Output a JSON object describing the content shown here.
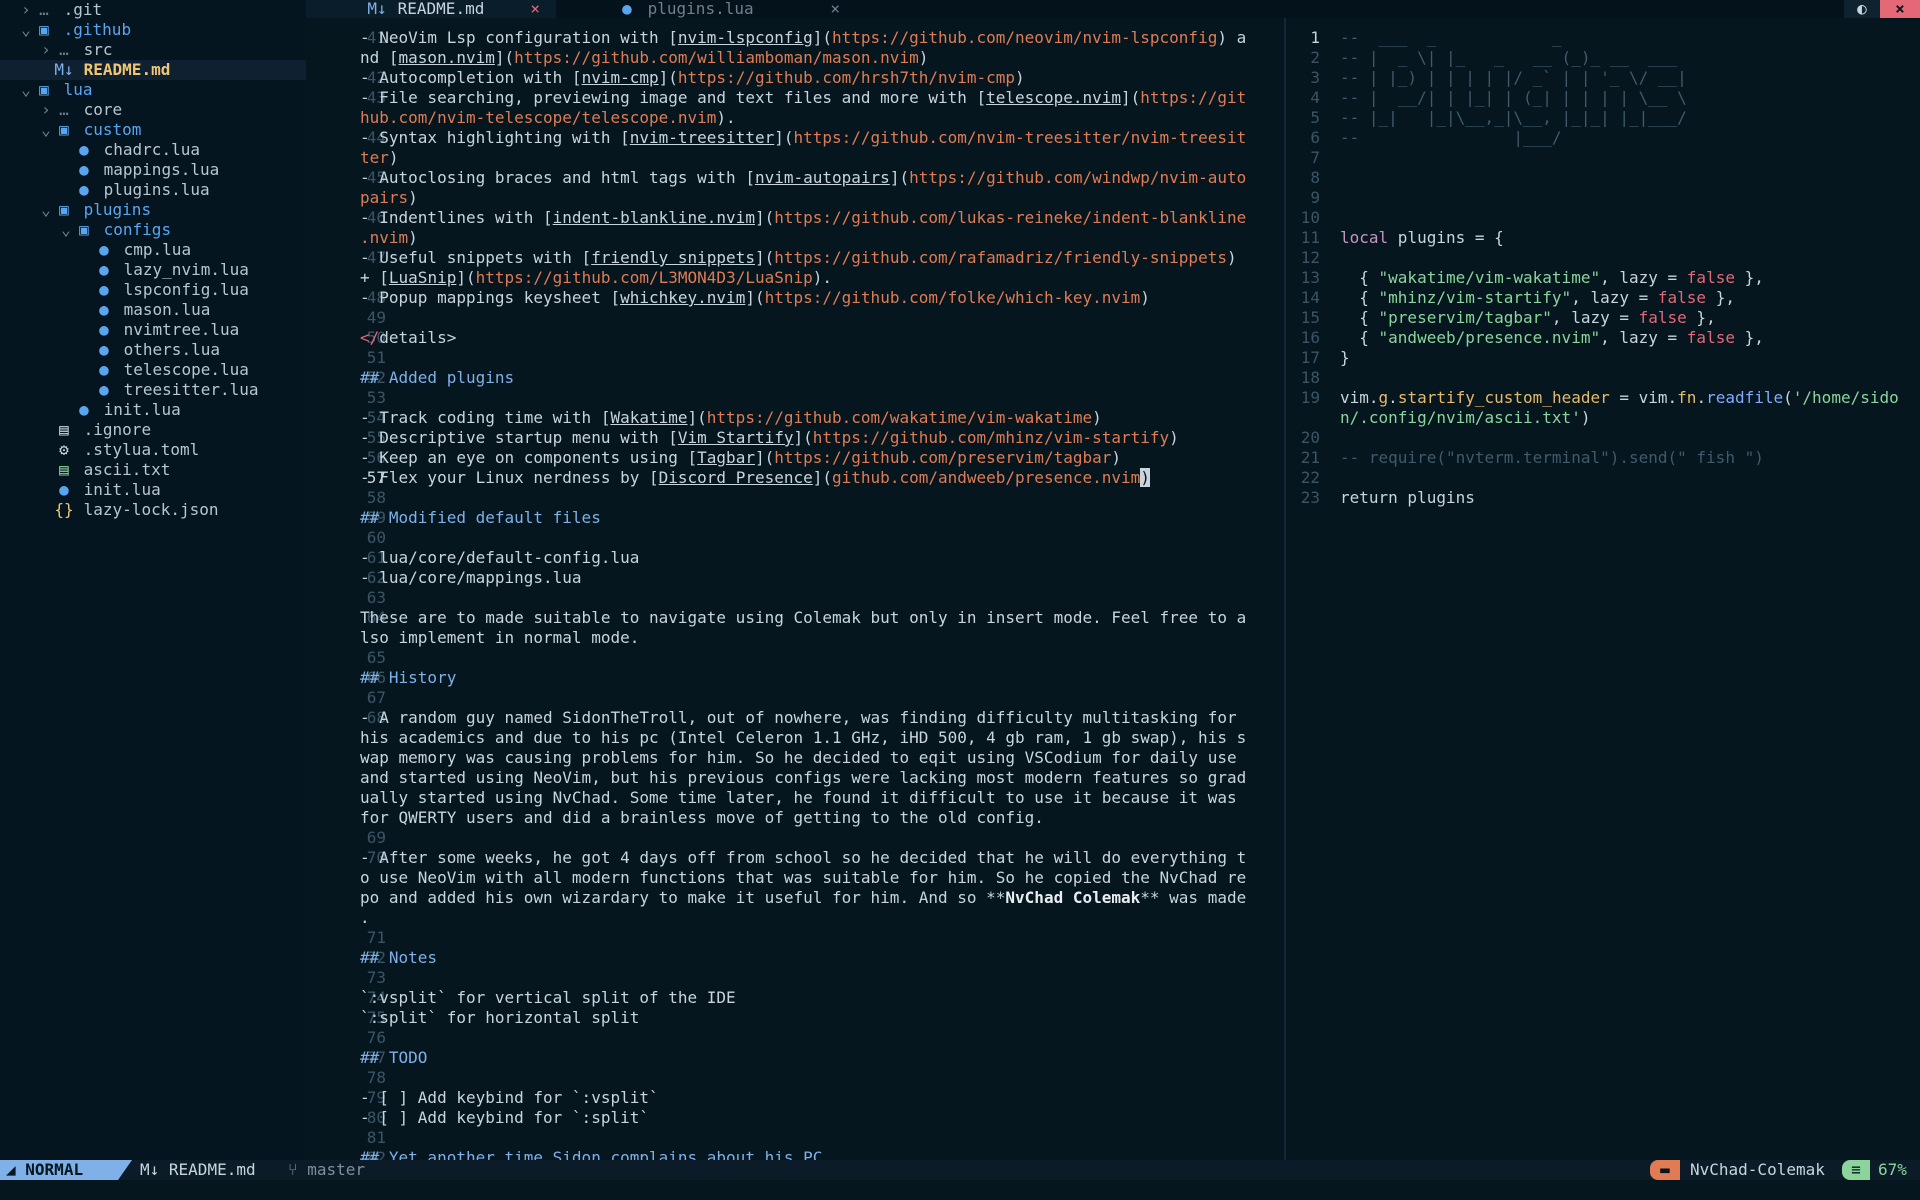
{
  "tree": [
    {
      "depth": 0,
      "arrow": "›",
      "icon": "…",
      "name": ".git",
      "kind": "hidden-dir",
      "icon_name": "dots-icon"
    },
    {
      "depth": 0,
      "arrow": "⌄",
      "icon": "▣",
      "name": ".github",
      "kind": "folder",
      "icon_name": "folder-open-icon"
    },
    {
      "depth": 1,
      "arrow": "›",
      "icon": "…",
      "name": "src",
      "kind": "hidden-dir",
      "icon_name": "dots-icon"
    },
    {
      "depth": 1,
      "arrow": "",
      "icon": "M↓",
      "name": "README.md",
      "kind": "active",
      "icon_name": "markdown-icon"
    },
    {
      "depth": 0,
      "arrow": "⌄",
      "icon": "▣",
      "name": "lua",
      "kind": "folder",
      "icon_name": "folder-open-icon"
    },
    {
      "depth": 1,
      "arrow": "›",
      "icon": "…",
      "name": "core",
      "kind": "hidden-dir",
      "icon_name": "dots-icon"
    },
    {
      "depth": 1,
      "arrow": "⌄",
      "icon": "▣",
      "name": "custom",
      "kind": "folder",
      "icon_name": "folder-open-icon"
    },
    {
      "depth": 2,
      "arrow": "",
      "icon": "●",
      "name": "chadrc.lua",
      "kind": "file",
      "icon_name": "lua-icon"
    },
    {
      "depth": 2,
      "arrow": "",
      "icon": "●",
      "name": "mappings.lua",
      "kind": "file",
      "icon_name": "lua-icon"
    },
    {
      "depth": 2,
      "arrow": "",
      "icon": "●",
      "name": "plugins.lua",
      "kind": "file",
      "icon_name": "lua-icon"
    },
    {
      "depth": 1,
      "arrow": "⌄",
      "icon": "▣",
      "name": "plugins",
      "kind": "folder",
      "icon_name": "folder-open-icon"
    },
    {
      "depth": 2,
      "arrow": "⌄",
      "icon": "▣",
      "name": "configs",
      "kind": "folder",
      "icon_name": "folder-open-icon"
    },
    {
      "depth": 3,
      "arrow": "",
      "icon": "●",
      "name": "cmp.lua",
      "kind": "file",
      "icon_name": "lua-icon"
    },
    {
      "depth": 3,
      "arrow": "",
      "icon": "●",
      "name": "lazy_nvim.lua",
      "kind": "file",
      "icon_name": "lua-icon"
    },
    {
      "depth": 3,
      "arrow": "",
      "icon": "●",
      "name": "lspconfig.lua",
      "kind": "file",
      "icon_name": "lua-icon"
    },
    {
      "depth": 3,
      "arrow": "",
      "icon": "●",
      "name": "mason.lua",
      "kind": "file",
      "icon_name": "lua-icon"
    },
    {
      "depth": 3,
      "arrow": "",
      "icon": "●",
      "name": "nvimtree.lua",
      "kind": "file",
      "icon_name": "lua-icon"
    },
    {
      "depth": 3,
      "arrow": "",
      "icon": "●",
      "name": "others.lua",
      "kind": "file",
      "icon_name": "lua-icon"
    },
    {
      "depth": 3,
      "arrow": "",
      "icon": "●",
      "name": "telescope.lua",
      "kind": "file",
      "icon_name": "lua-icon"
    },
    {
      "depth": 3,
      "arrow": "",
      "icon": "●",
      "name": "treesitter.lua",
      "kind": "file",
      "icon_name": "lua-icon"
    },
    {
      "depth": 2,
      "arrow": "",
      "icon": "●",
      "name": "init.lua",
      "kind": "file",
      "icon_name": "lua-icon"
    },
    {
      "depth": 1,
      "arrow": "",
      "icon": "▤",
      "name": ".ignore",
      "kind": "file",
      "icon_name": "text-file-icon"
    },
    {
      "depth": 1,
      "arrow": "",
      "icon": "⚙",
      "name": ".stylua.toml",
      "kind": "file",
      "icon_name": "gear-icon"
    },
    {
      "depth": 1,
      "arrow": "",
      "icon": "▤",
      "name": "ascii.txt",
      "kind": "file",
      "icon_name": "text-file-icon"
    },
    {
      "depth": 1,
      "arrow": "",
      "icon": "●",
      "name": "init.lua",
      "kind": "file",
      "icon_name": "lua-icon"
    },
    {
      "depth": 1,
      "arrow": "",
      "icon": "{}",
      "name": "lazy-lock.json",
      "kind": "file",
      "icon_name": "json-icon"
    }
  ],
  "tabs": [
    {
      "label": "README.md",
      "icon": "M↓",
      "close": "×"
    },
    {
      "label": "plugins.lua",
      "icon": "●",
      "close": "×"
    }
  ],
  "topbar": {
    "toggle": "◐",
    "close": "×"
  },
  "left_lines": [
    {
      "n": "41",
      "segs": [
        [
          "pn",
          "- NeoVim Lsp configuration with ["
        ],
        [
          "lnk",
          "nvim-lspconfig"
        ],
        [
          "pn",
          "]("
        ],
        [
          "url",
          "https://github.com/neovim/nvim-lspconfig"
        ],
        [
          "pn",
          ") a"
        ]
      ]
    },
    {
      "n": "",
      "segs": [
        [
          "pn",
          "nd ["
        ],
        [
          "lnk",
          "mason.nvim"
        ],
        [
          "pn",
          "]("
        ],
        [
          "url",
          "https://github.com/williamboman/mason.nvim"
        ],
        [
          "pn",
          ")"
        ]
      ]
    },
    {
      "n": "42",
      "segs": [
        [
          "pn",
          "- Autocompletion with ["
        ],
        [
          "lnk",
          "nvim-cmp"
        ],
        [
          "pn",
          "]("
        ],
        [
          "url",
          "https://github.com/hrsh7th/nvim-cmp"
        ],
        [
          "pn",
          ")"
        ]
      ]
    },
    {
      "n": "43",
      "segs": [
        [
          "pn",
          "- File searching, previewing image and text files and more with ["
        ],
        [
          "lnk",
          "telescope.nvim"
        ],
        [
          "pn",
          "]("
        ],
        [
          "url",
          "https://git"
        ]
      ]
    },
    {
      "n": "",
      "segs": [
        [
          "url",
          "hub.com/nvim-telescope/telescope.nvim"
        ],
        [
          "pn",
          ")."
        ]
      ]
    },
    {
      "n": "44",
      "segs": [
        [
          "pn",
          "- Syntax highlighting with ["
        ],
        [
          "lnk",
          "nvim-treesitter"
        ],
        [
          "pn",
          "]("
        ],
        [
          "url",
          "https://github.com/nvim-treesitter/nvim-treesit"
        ]
      ]
    },
    {
      "n": "",
      "segs": [
        [
          "url",
          "ter"
        ],
        [
          "pn",
          ")"
        ]
      ]
    },
    {
      "n": "45",
      "segs": [
        [
          "pn",
          "- Autoclosing braces and html tags with ["
        ],
        [
          "lnk",
          "nvim-autopairs"
        ],
        [
          "pn",
          "]("
        ],
        [
          "url",
          "https://github.com/windwp/nvim-auto"
        ]
      ]
    },
    {
      "n": "",
      "segs": [
        [
          "url",
          "pairs"
        ],
        [
          "pn",
          ")"
        ]
      ]
    },
    {
      "n": "46",
      "segs": [
        [
          "pn",
          "- Indentlines with ["
        ],
        [
          "lnk",
          "indent-blankline.nvim"
        ],
        [
          "pn",
          "]("
        ],
        [
          "url",
          "https://github.com/lukas-reineke/indent-blankline"
        ]
      ]
    },
    {
      "n": "",
      "segs": [
        [
          "url",
          ".nvim"
        ],
        [
          "pn",
          ")"
        ]
      ]
    },
    {
      "n": "47",
      "segs": [
        [
          "pn",
          "- Useful snippets with ["
        ],
        [
          "lnk",
          "friendly snippets"
        ],
        [
          "pn",
          "]("
        ],
        [
          "url",
          "https://github.com/rafamadriz/friendly-snippets"
        ],
        [
          "pn",
          ")"
        ]
      ]
    },
    {
      "n": "",
      "segs": [
        [
          "pn",
          "+ ["
        ],
        [
          "lnk",
          "LuaSnip"
        ],
        [
          "pn",
          "]("
        ],
        [
          "url",
          "https://github.com/L3MON4D3/LuaSnip"
        ],
        [
          "pn",
          ")."
        ]
      ]
    },
    {
      "n": "48",
      "segs": [
        [
          "pn",
          "- Popup mappings keysheet ["
        ],
        [
          "lnk",
          "whichkey.nvim"
        ],
        [
          "pn",
          "]("
        ],
        [
          "url",
          "https://github.com/folke/which-key.nvim"
        ],
        [
          "pn",
          ")"
        ]
      ]
    },
    {
      "n": "49",
      "segs": []
    },
    {
      "n": "50",
      "segs": [
        [
          "tag",
          "</"
        ],
        [
          "pn",
          "details>"
        ]
      ]
    },
    {
      "n": "51",
      "segs": []
    },
    {
      "n": "52",
      "segs": [
        [
          "h",
          "## Added plugins"
        ]
      ]
    },
    {
      "n": "53",
      "segs": []
    },
    {
      "n": "54",
      "segs": [
        [
          "pn",
          "- Track coding time with ["
        ],
        [
          "lnk",
          "Wakatime"
        ],
        [
          "pn",
          "]("
        ],
        [
          "url",
          "https://github.com/wakatime/vim-wakatime"
        ],
        [
          "pn",
          ")"
        ]
      ]
    },
    {
      "n": "55",
      "segs": [
        [
          "pn",
          "- Descriptive startup menu with ["
        ],
        [
          "lnk",
          "Vim Startify"
        ],
        [
          "pn",
          "]("
        ],
        [
          "url",
          "https://github.com/mhinz/vim-startify"
        ],
        [
          "pn",
          ")"
        ]
      ]
    },
    {
      "n": "56",
      "segs": [
        [
          "pn",
          "- Keep an eye on components using ["
        ],
        [
          "lnk",
          "Tagbar"
        ],
        [
          "pn",
          "]("
        ],
        [
          "url",
          "https://github.com/preservim/tagbar"
        ],
        [
          "pn",
          ")"
        ]
      ]
    },
    {
      "n": "57",
      "cur": true,
      "segs": [
        [
          "pn",
          "- Flex your Linux nerdness by ["
        ],
        [
          "lnk",
          "Discord Presence"
        ],
        [
          "pn",
          "]("
        ],
        [
          "url",
          "github.com/andweeb/presence.nvim"
        ],
        [
          "cursor",
          ")"
        ]
      ]
    },
    {
      "n": "58",
      "segs": []
    },
    {
      "n": "59",
      "segs": [
        [
          "h",
          "## Modified default files"
        ]
      ]
    },
    {
      "n": "60",
      "segs": []
    },
    {
      "n": "61",
      "segs": [
        [
          "pn",
          "- lua/core/default-config.lua"
        ]
      ]
    },
    {
      "n": "62",
      "segs": [
        [
          "pn",
          "- lua/core/mappings.lua"
        ]
      ]
    },
    {
      "n": "63",
      "segs": []
    },
    {
      "n": "64",
      "segs": [
        [
          "pn",
          "These are to made suitable to navigate using Colemak but only in insert mode. Feel free to a"
        ]
      ]
    },
    {
      "n": "",
      "segs": [
        [
          "pn",
          "lso implement in normal mode."
        ]
      ]
    },
    {
      "n": "65",
      "segs": []
    },
    {
      "n": "66",
      "segs": [
        [
          "h",
          "## History"
        ]
      ]
    },
    {
      "n": "67",
      "segs": []
    },
    {
      "n": "68",
      "segs": [
        [
          "pn",
          "- A random guy named SidonTheTroll, out of nowhere, was finding difficulty multitasking for"
        ]
      ]
    },
    {
      "n": "",
      "segs": [
        [
          "pn",
          "his academics and due to his pc (Intel Celeron 1.1 GHz, iHD 500, 4 gb ram, 1 gb swap), his s"
        ]
      ]
    },
    {
      "n": "",
      "segs": [
        [
          "pn",
          "wap memory was causing problems for him. So he decided to eqit using VSCodium for daily use"
        ]
      ]
    },
    {
      "n": "",
      "segs": [
        [
          "pn",
          "and started using NeoVim, but his previous configs were lacking most modern features so grad"
        ]
      ]
    },
    {
      "n": "",
      "segs": [
        [
          "pn",
          "ually started using NvChad. Some time later, he found it difficult to use it because it was"
        ]
      ]
    },
    {
      "n": "",
      "segs": [
        [
          "pn",
          "for QWERTY users and did a brainless move of getting to the old config."
        ]
      ]
    },
    {
      "n": "69",
      "segs": []
    },
    {
      "n": "70",
      "segs": [
        [
          "pn",
          "- After some weeks, he got 4 days off from school so he decided that he will do everything t"
        ]
      ]
    },
    {
      "n": "",
      "segs": [
        [
          "pn",
          "o use NeoVim with all modern functions that was suitable for him. So he copied the NvChad re"
        ]
      ]
    },
    {
      "n": "",
      "segs": [
        [
          "pn",
          "po and added his own wizardary to make it useful for him. And so **"
        ],
        [
          "bold",
          "NvChad Colemak"
        ],
        [
          "pn",
          "** was made"
        ]
      ]
    },
    {
      "n": "",
      "segs": [
        [
          "pn",
          "."
        ]
      ]
    },
    {
      "n": "71",
      "segs": []
    },
    {
      "n": "72",
      "segs": [
        [
          "h",
          "## Notes"
        ]
      ]
    },
    {
      "n": "73",
      "segs": []
    },
    {
      "n": "74",
      "segs": [
        [
          "pn",
          "`:vsplit` for vertical split of the IDE"
        ]
      ]
    },
    {
      "n": "75",
      "segs": [
        [
          "pn",
          "`:split` for horizontal split"
        ]
      ]
    },
    {
      "n": "76",
      "segs": []
    },
    {
      "n": "77",
      "segs": [
        [
          "h",
          "## TODO"
        ]
      ]
    },
    {
      "n": "78",
      "segs": []
    },
    {
      "n": "79",
      "segs": [
        [
          "pn",
          "- [ ] Add keybind for `:vsplit`"
        ]
      ]
    },
    {
      "n": "80",
      "segs": [
        [
          "pn",
          "- [ ] Add keybind for `:split`"
        ]
      ]
    },
    {
      "n": "81",
      "segs": []
    },
    {
      "n": "82",
      "segs": [
        [
          "h",
          "## Yet another time Sidon complains about his PC"
        ]
      ]
    }
  ],
  "right_lines": [
    {
      "n": "1",
      "cur": true,
      "segs": [
        [
          "dim",
          "--  ___  _            _"
        ]
      ]
    },
    {
      "n": "2",
      "segs": [
        [
          "dim",
          "-- |  _ \\| |_   _   __ (_)_ __  ___"
        ]
      ]
    },
    {
      "n": "3",
      "segs": [
        [
          "dim",
          "-- | |_) | | | | |/ _` | | '_ \\/ __|"
        ]
      ]
    },
    {
      "n": "4",
      "segs": [
        [
          "dim",
          "-- |  __/| | |_| | (_| | | | | \\__ \\"
        ]
      ]
    },
    {
      "n": "5",
      "segs": [
        [
          "dim",
          "-- |_|   |_|\\__,_|\\__, |_|_| |_|___/"
        ]
      ]
    },
    {
      "n": "6",
      "segs": [
        [
          "dim",
          "--                |___/"
        ]
      ]
    },
    {
      "n": "7",
      "segs": []
    },
    {
      "n": "8",
      "segs": []
    },
    {
      "n": "9",
      "segs": []
    },
    {
      "n": "10",
      "segs": []
    },
    {
      "n": "11",
      "segs": [
        [
          "kw",
          "local"
        ],
        [
          "pn",
          " plugins = {"
        ]
      ]
    },
    {
      "n": "12",
      "segs": []
    },
    {
      "n": "13",
      "segs": [
        [
          "pn",
          "  { "
        ],
        [
          "str",
          "\"wakatime/vim-wakatime\""
        ],
        [
          "pn",
          ", lazy = "
        ],
        [
          "bool",
          "false"
        ],
        [
          "pn",
          " },"
        ]
      ]
    },
    {
      "n": "14",
      "segs": [
        [
          "pn",
          "  { "
        ],
        [
          "str",
          "\"mhinz/vim-startify\""
        ],
        [
          "pn",
          ", lazy = "
        ],
        [
          "bool",
          "false"
        ],
        [
          "pn",
          " },"
        ]
      ]
    },
    {
      "n": "15",
      "segs": [
        [
          "pn",
          "  { "
        ],
        [
          "str",
          "\"preservim/tagbar\""
        ],
        [
          "pn",
          ", lazy = "
        ],
        [
          "bool",
          "false"
        ],
        [
          "pn",
          " },"
        ]
      ]
    },
    {
      "n": "16",
      "segs": [
        [
          "pn",
          "  { "
        ],
        [
          "str",
          "\"andweeb/presence.nvim\""
        ],
        [
          "pn",
          ", lazy = "
        ],
        [
          "bool",
          "false"
        ],
        [
          "pn",
          " },"
        ]
      ]
    },
    {
      "n": "17",
      "segs": [
        [
          "pn",
          "}"
        ]
      ]
    },
    {
      "n": "18",
      "segs": []
    },
    {
      "n": "19",
      "segs": [
        [
          "pn",
          "vim."
        ],
        [
          "fld",
          "g"
        ],
        [
          "pn",
          "."
        ],
        [
          "fld",
          "startify_custom_header"
        ],
        [
          "pn",
          " = vim."
        ],
        [
          "fld",
          "fn"
        ],
        [
          "pn",
          "."
        ],
        [
          "fn",
          "readfile"
        ],
        [
          "pn",
          "("
        ],
        [
          "str",
          "'/home/sido"
        ]
      ]
    },
    {
      "n": "",
      "segs": [
        [
          "str",
          "n/.config/nvim/ascii.txt'"
        ],
        [
          "pn",
          ")"
        ]
      ]
    },
    {
      "n": "20",
      "segs": []
    },
    {
      "n": "21",
      "segs": [
        [
          "dim",
          "-- require(\"nvterm.terminal\").send(\" fish \")"
        ]
      ]
    },
    {
      "n": "22",
      "segs": []
    },
    {
      "n": "23",
      "segs": [
        [
          "pn",
          "return plugins"
        ]
      ]
    }
  ],
  "status": {
    "mode_icon": "◢",
    "mode": "NORMAL",
    "file_icon": "M↓",
    "file": "README.md",
    "branch_icon": "⑂",
    "branch": "master",
    "project_icon": "▬",
    "project": "NvChad-Colemak",
    "pct_icon": "≡",
    "pct": "67%"
  }
}
